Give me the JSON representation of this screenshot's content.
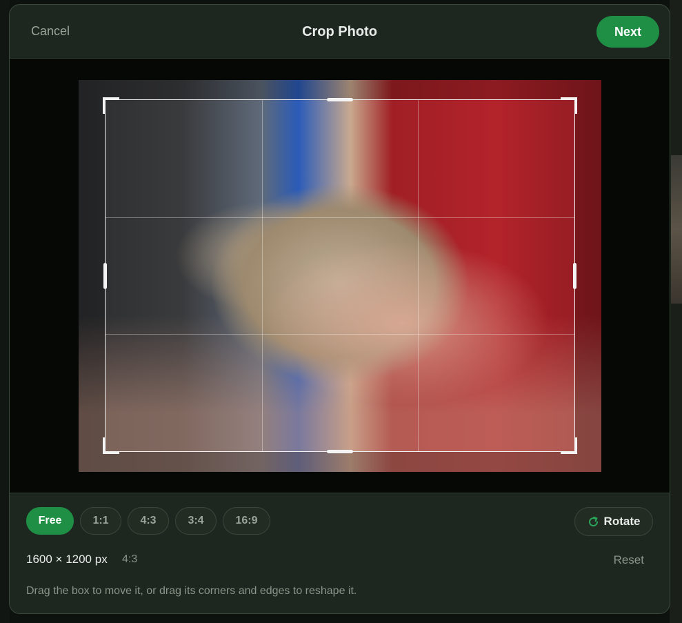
{
  "header": {
    "cancel_label": "Cancel",
    "title": "Crop Photo",
    "next_label": "Next"
  },
  "crop": {
    "aspect_options": [
      "Free",
      "1:1",
      "4:3",
      "3:4",
      "16:9"
    ],
    "selected_option": "Free",
    "rotate_label": "Rotate",
    "rotate_icon": "rotate-clockwise-icon",
    "dimensions": "1600 × 1200 px",
    "current_ratio": "4:3",
    "reset_label": "Reset",
    "hint": "Drag the box to move it, or drag its corners and edges to reshape it."
  },
  "colors": {
    "accent": "#1f8f45",
    "modal_bg": "#1e271f",
    "canvas_bg": "#050805"
  }
}
